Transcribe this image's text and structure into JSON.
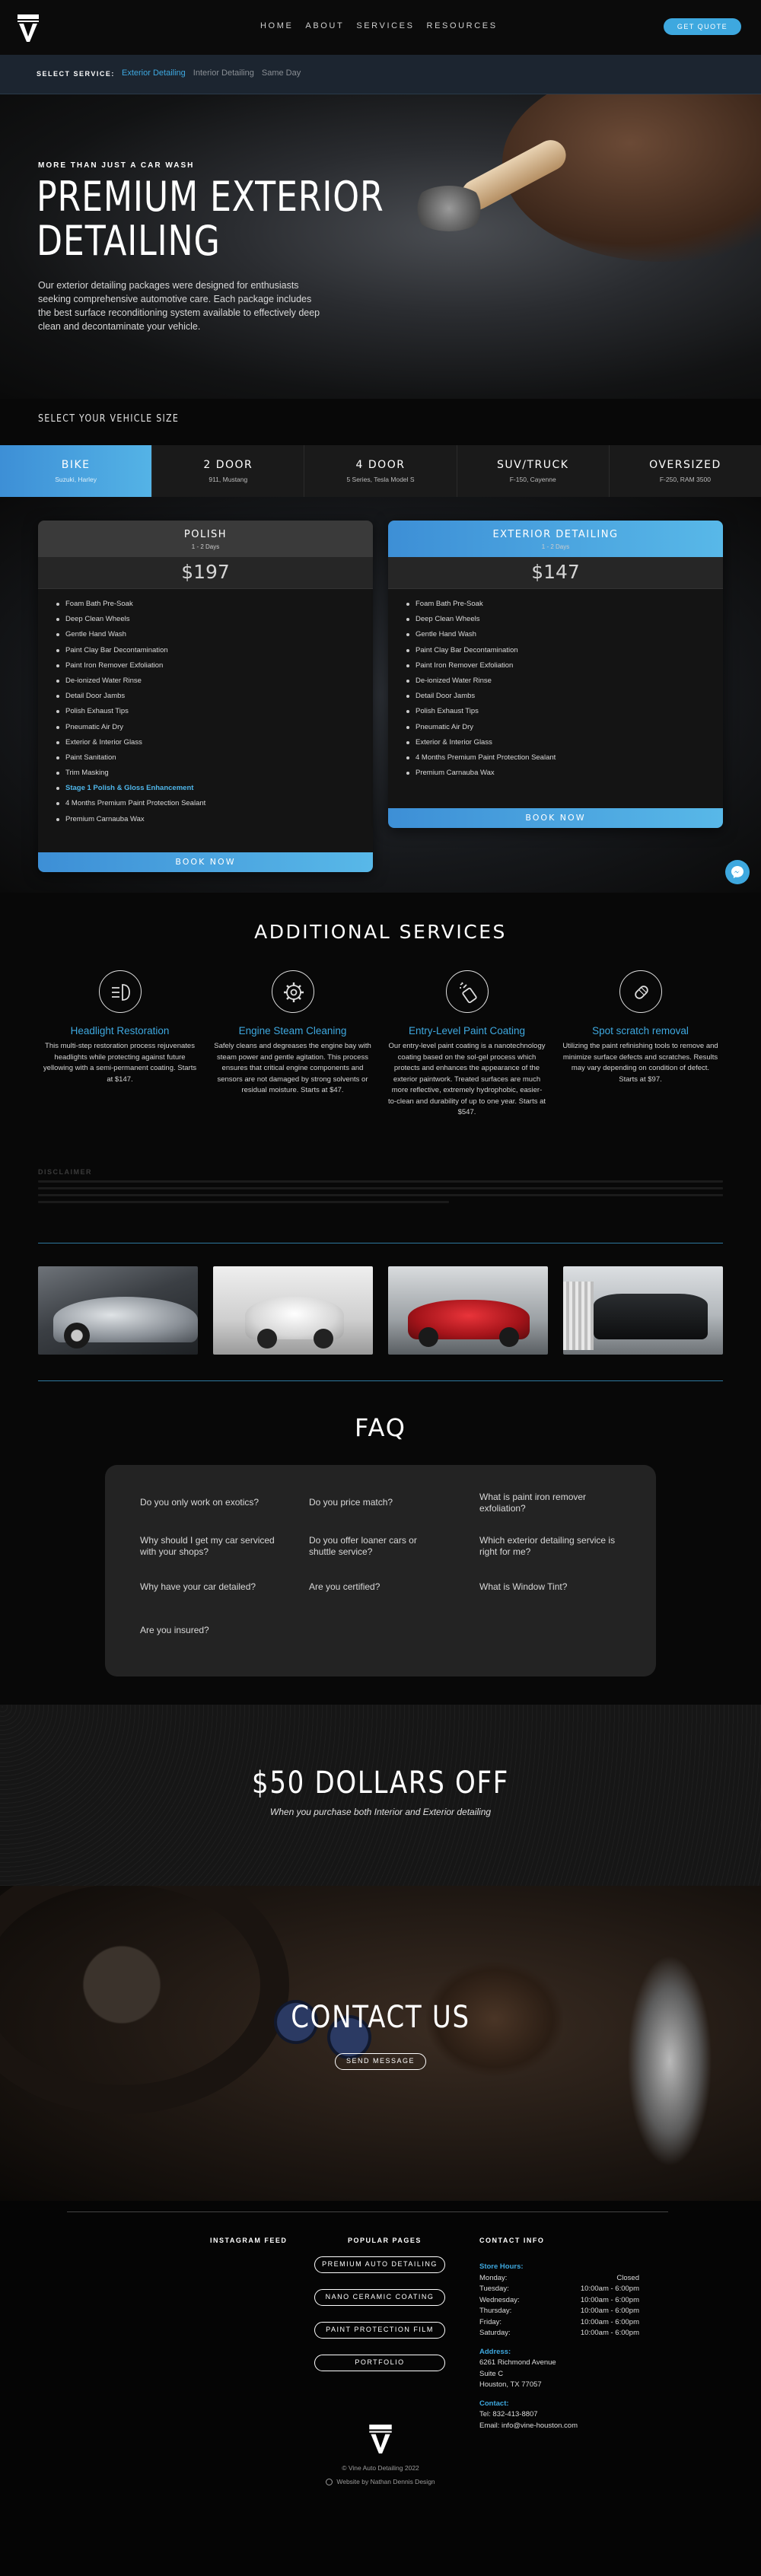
{
  "colors": {
    "accent": "#3ea8df",
    "bg": "#080808"
  },
  "header": {
    "nav": [
      "HOME",
      "ABOUT",
      "SERVICES",
      "RESOURCES"
    ],
    "cta": "GET QUOTE"
  },
  "service_bar": {
    "label": "SELECT SERVICE:",
    "options": [
      "Exterior Detailing",
      "Interior Detailing",
      "Same Day"
    ],
    "selected": "Exterior Detailing"
  },
  "hero": {
    "kicker": "MORE THAN JUST A CAR WASH",
    "title_line1": "PREMIUM EXTERIOR",
    "title_line2": "DETAILING",
    "description": "Our exterior detailing packages were designed for enthusiasts seeking comprehensive automotive care. Each package includes the best surface reconditioning system available to effectively deep clean and decontaminate your vehicle."
  },
  "vehicle_size": {
    "label": "SELECT YOUR VEHICLE SIZE",
    "selected": "BIKE",
    "options": [
      {
        "name": "BIKE",
        "sub": "Suzuki, Harley"
      },
      {
        "name": "2 DOOR",
        "sub": "911, Mustang"
      },
      {
        "name": "4 DOOR",
        "sub": "5 Series, Tesla Model S"
      },
      {
        "name": "SUV/TRUCK",
        "sub": "F-150, Cayenne"
      },
      {
        "name": "OVERSIZED",
        "sub": "F-250, RAM 3500"
      }
    ]
  },
  "packages": [
    {
      "name": "POLISH",
      "duration": "1 - 2 Days",
      "price": "$197",
      "book": "BOOK NOW",
      "items": [
        "Foam Bath Pre-Soak",
        "Deep Clean Wheels",
        "Gentle Hand Wash",
        "Paint Clay Bar Decontamination",
        "Paint Iron Remover Exfoliation",
        "De-ionized Water Rinse",
        "Detail Door Jambs",
        "Polish Exhaust Tips",
        "Pneumatic Air Dry",
        "Exterior & Interior Glass",
        "Paint Sanitation",
        "Trim Masking",
        "Stage 1 Polish & Gloss Enhancement",
        "4 Months Premium Paint Protection Sealant",
        "Premium Carnauba Wax"
      ],
      "highlight_index": 12
    },
    {
      "name": "EXTERIOR DETAILING",
      "duration": "1 - 2 Days",
      "price": "$147",
      "book": "BOOK NOW",
      "items": [
        "Foam Bath Pre-Soak",
        "Deep Clean Wheels",
        "Gentle Hand Wash",
        "Paint Clay Bar Decontamination",
        "Paint Iron Remover Exfoliation",
        "De-ionized Water Rinse",
        "Detail Door Jambs",
        "Polish Exhaust Tips",
        "Pneumatic Air Dry",
        "Exterior & Interior Glass",
        "4 Months Premium Paint Protection Sealant",
        "Premium Carnauba Wax"
      ]
    }
  ],
  "additional": {
    "title": "ADDITIONAL SERVICES",
    "items": [
      {
        "icon": "headlight-icon",
        "title": "Headlight Restoration",
        "text": "This multi-step restoration process rejuvenates headlights while protecting against future yellowing with a semi-permanent coating. Starts at $147."
      },
      {
        "icon": "engine-gear-icon",
        "title": "Engine Steam Cleaning",
        "text": "Safely cleans and degreases the engine bay with steam power and gentle agitation. This process ensures that critical engine components and sensors are not damaged by strong solvents or residual moisture. Starts at $47."
      },
      {
        "icon": "spray-bottle-icon",
        "title": "Entry-Level Paint Coating",
        "text": "Our entry-level paint coating is a nanotechnology coating based on the sol-gel process which protects and enhances the appearance of the exterior paintwork. Treated surfaces are much more reflective, extremely hydrophobic, easier-to-clean and durability of up to one year. Starts at $547."
      },
      {
        "icon": "bandage-icon",
        "title": "Spot scratch removal",
        "text": "Utilizing the paint refinishing tools to remove and minimize surface defects and scratches. Results may vary depending on condition of defect. Starts at $97."
      }
    ]
  },
  "disclaimer": {
    "title": "DISCLAIMER"
  },
  "faq": {
    "title": "FAQ",
    "questions": [
      "Do you only work on exotics?",
      "Do you price match?",
      "What is paint iron remover exfoliation?",
      "Why should I get my car serviced with your shops?",
      "Do you offer loaner cars or shuttle service?",
      "Which exterior detailing service is right for me?",
      "Why have your car detailed?",
      "Are you certified?",
      "What is Window Tint?",
      "Are you insured?"
    ]
  },
  "promo": {
    "title": "$50 DOLLARS OFF",
    "subtitle": "When you purchase both Interior and Exterior detailing"
  },
  "contact": {
    "title": "CONTACT US",
    "button": "SEND MESSAGE"
  },
  "footer": {
    "instagram_title": "INSTAGRAM FEED",
    "pages_title": "POPULAR PAGES",
    "contact_title": "CONTACT INFO",
    "pages": [
      "PREMIUM AUTO DETAILING",
      "NANO CERAMIC COATING",
      "PAINT PROTECTION FILM",
      "PORTFOLIO"
    ],
    "hours_label": "Store Hours:",
    "hours": [
      [
        "Monday:",
        "Closed"
      ],
      [
        "Tuesday:",
        "10:00am - 6:00pm"
      ],
      [
        "Wednesday:",
        "10:00am - 6:00pm"
      ],
      [
        "Thursday:",
        "10:00am - 6:00pm"
      ],
      [
        "Friday:",
        "10:00am - 6:00pm"
      ],
      [
        "Saturday:",
        "10:00am - 6:00pm"
      ]
    ],
    "address_label": "Address:",
    "address": [
      "6261 Richmond Avenue",
      "Suite C",
      "Houston, TX 77057"
    ],
    "contact_label": "Contact:",
    "phone": "Tel: 832-413-8807",
    "email": "Email: info@vine-houston.com",
    "copyright": "© Vine Auto Detailing 2022",
    "credit": "Website by Nathan Dennis Design"
  }
}
